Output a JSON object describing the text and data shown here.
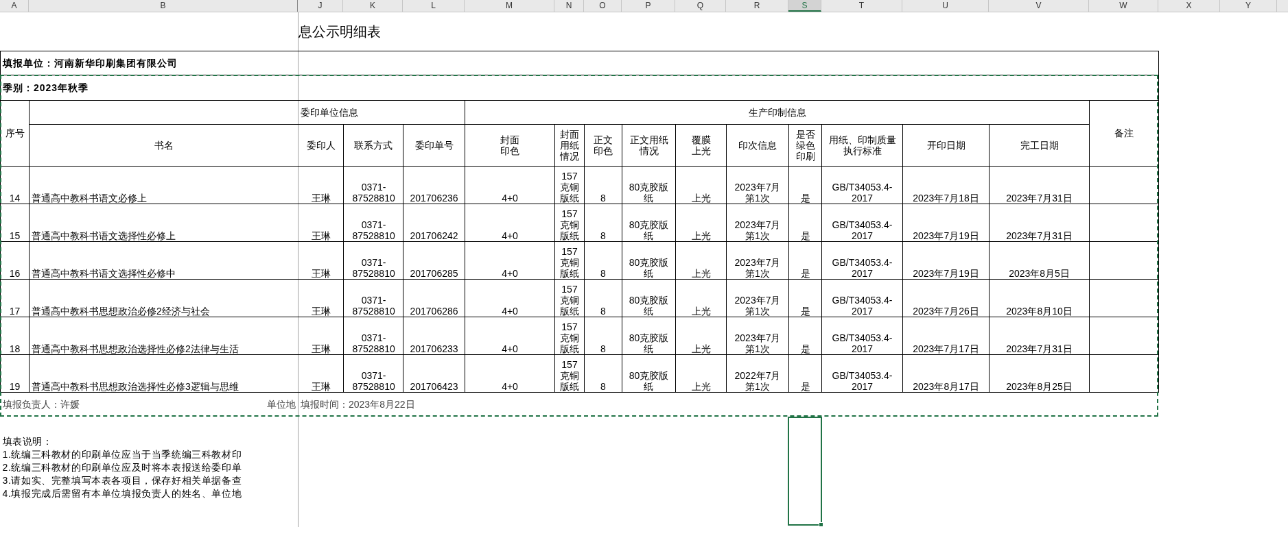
{
  "column_headers": [
    {
      "label": "A",
      "selected": false
    },
    {
      "label": "B",
      "selected": false
    },
    {
      "label": "J",
      "selected": false
    },
    {
      "label": "K",
      "selected": false
    },
    {
      "label": "L",
      "selected": false
    },
    {
      "label": "M",
      "selected": false
    },
    {
      "label": "N",
      "selected": false
    },
    {
      "label": "O",
      "selected": false
    },
    {
      "label": "P",
      "selected": false
    },
    {
      "label": "Q",
      "selected": false
    },
    {
      "label": "R",
      "selected": false
    },
    {
      "label": "S",
      "selected": true
    },
    {
      "label": "T",
      "selected": false
    },
    {
      "label": "U",
      "selected": false
    },
    {
      "label": "V",
      "selected": false
    },
    {
      "label": "W",
      "selected": false
    },
    {
      "label": "X",
      "selected": false
    },
    {
      "label": "Y",
      "selected": false
    }
  ],
  "sheet": {
    "title": "息公示明细表",
    "reporting_unit": "填报单位：河南新华印刷集团有限公司",
    "season": "季别：2023年秋季",
    "table": {
      "group_headers": [
        "委印单位信息",
        "生产印制信息"
      ],
      "columns": [
        "序号",
        "书名",
        "委印人",
        "联系方式",
        "委印单号",
        "封面印色",
        "封面用纸情况",
        "正文印色",
        "正文用纸情况",
        "覆膜上光",
        "印次信息",
        "是否绿色印刷",
        "用纸、印制质量执行标准",
        "开印日期",
        "完工日期",
        "备注"
      ],
      "rows": [
        [
          "14",
          "普通高中教科书语文必修上",
          "王琳",
          "0371-87528810",
          "201706236",
          "4+0",
          "157克铜版纸",
          "8",
          "80克胶版纸",
          "上光",
          "2023年7月第1次",
          "是",
          "GB/T34053.4-2017",
          "2023年7月18日",
          "2023年7月31日"
        ],
        [
          "15",
          "普通高中教科书语文选择性必修上",
          "王琳",
          "0371-87528810",
          "201706242",
          "4+0",
          "157克铜版纸",
          "8",
          "80克胶版纸",
          "上光",
          "2023年7月第1次",
          "是",
          "GB/T34053.4-2017",
          "2023年7月19日",
          "2023年7月31日"
        ],
        [
          "16",
          "普通高中教科书语文选择性必修中",
          "王琳",
          "0371-87528810",
          "201706285",
          "4+0",
          "157克铜版纸",
          "8",
          "80克胶版纸",
          "上光",
          "2023年7月第1次",
          "是",
          "GB/T34053.4-2017",
          "2023年7月19日",
          "2023年8月5日"
        ],
        [
          "17",
          "普通高中教科书思想政治必修2经济与社会",
          "王琳",
          "0371-87528810",
          "201706286",
          "4+0",
          "157克铜版纸",
          "8",
          "80克胶版纸",
          "上光",
          "2023年7月第1次",
          "是",
          "GB/T34053.4-2017",
          "2023年7月26日",
          "2023年8月10日"
        ],
        [
          "18",
          "普通高中教科书思想政治选择性必修2法律与生活",
          "王琳",
          "0371-87528810",
          "201706233",
          "4+0",
          "157克铜版纸",
          "8",
          "80克胶版纸",
          "上光",
          "2023年7月第1次",
          "是",
          "GB/T34053.4-2017",
          "2023年7月17日",
          "2023年7月31日"
        ],
        [
          "19",
          "普通高中教科书思想政治选择性必修3逻辑与思维",
          "王琳",
          "0371-87528810",
          "201706423",
          "4+0",
          "157克铜版纸",
          "8",
          "80克胶版纸",
          "上光",
          "2022年7月第1次",
          "是",
          "GB/T34053.4-2017",
          "2023年8月17日",
          "2023年8月25日"
        ]
      ]
    },
    "footer": {
      "responsible": "填报负责人：许媛",
      "address": "单位地",
      "time": "填报时间：2023年8月22日"
    },
    "notes_title": "填表说明：",
    "notes": [
      "1.统编三科教材的印刷单位应当于当季统编三科教材印",
      "2.统编三科教材的印刷单位应及时将本表报送给委印单",
      "3.请如实、完整填写本表各项目，保存好相关单据备查",
      "4.填报完成后需留有本单位填报负责人的姓名、单位地"
    ]
  }
}
